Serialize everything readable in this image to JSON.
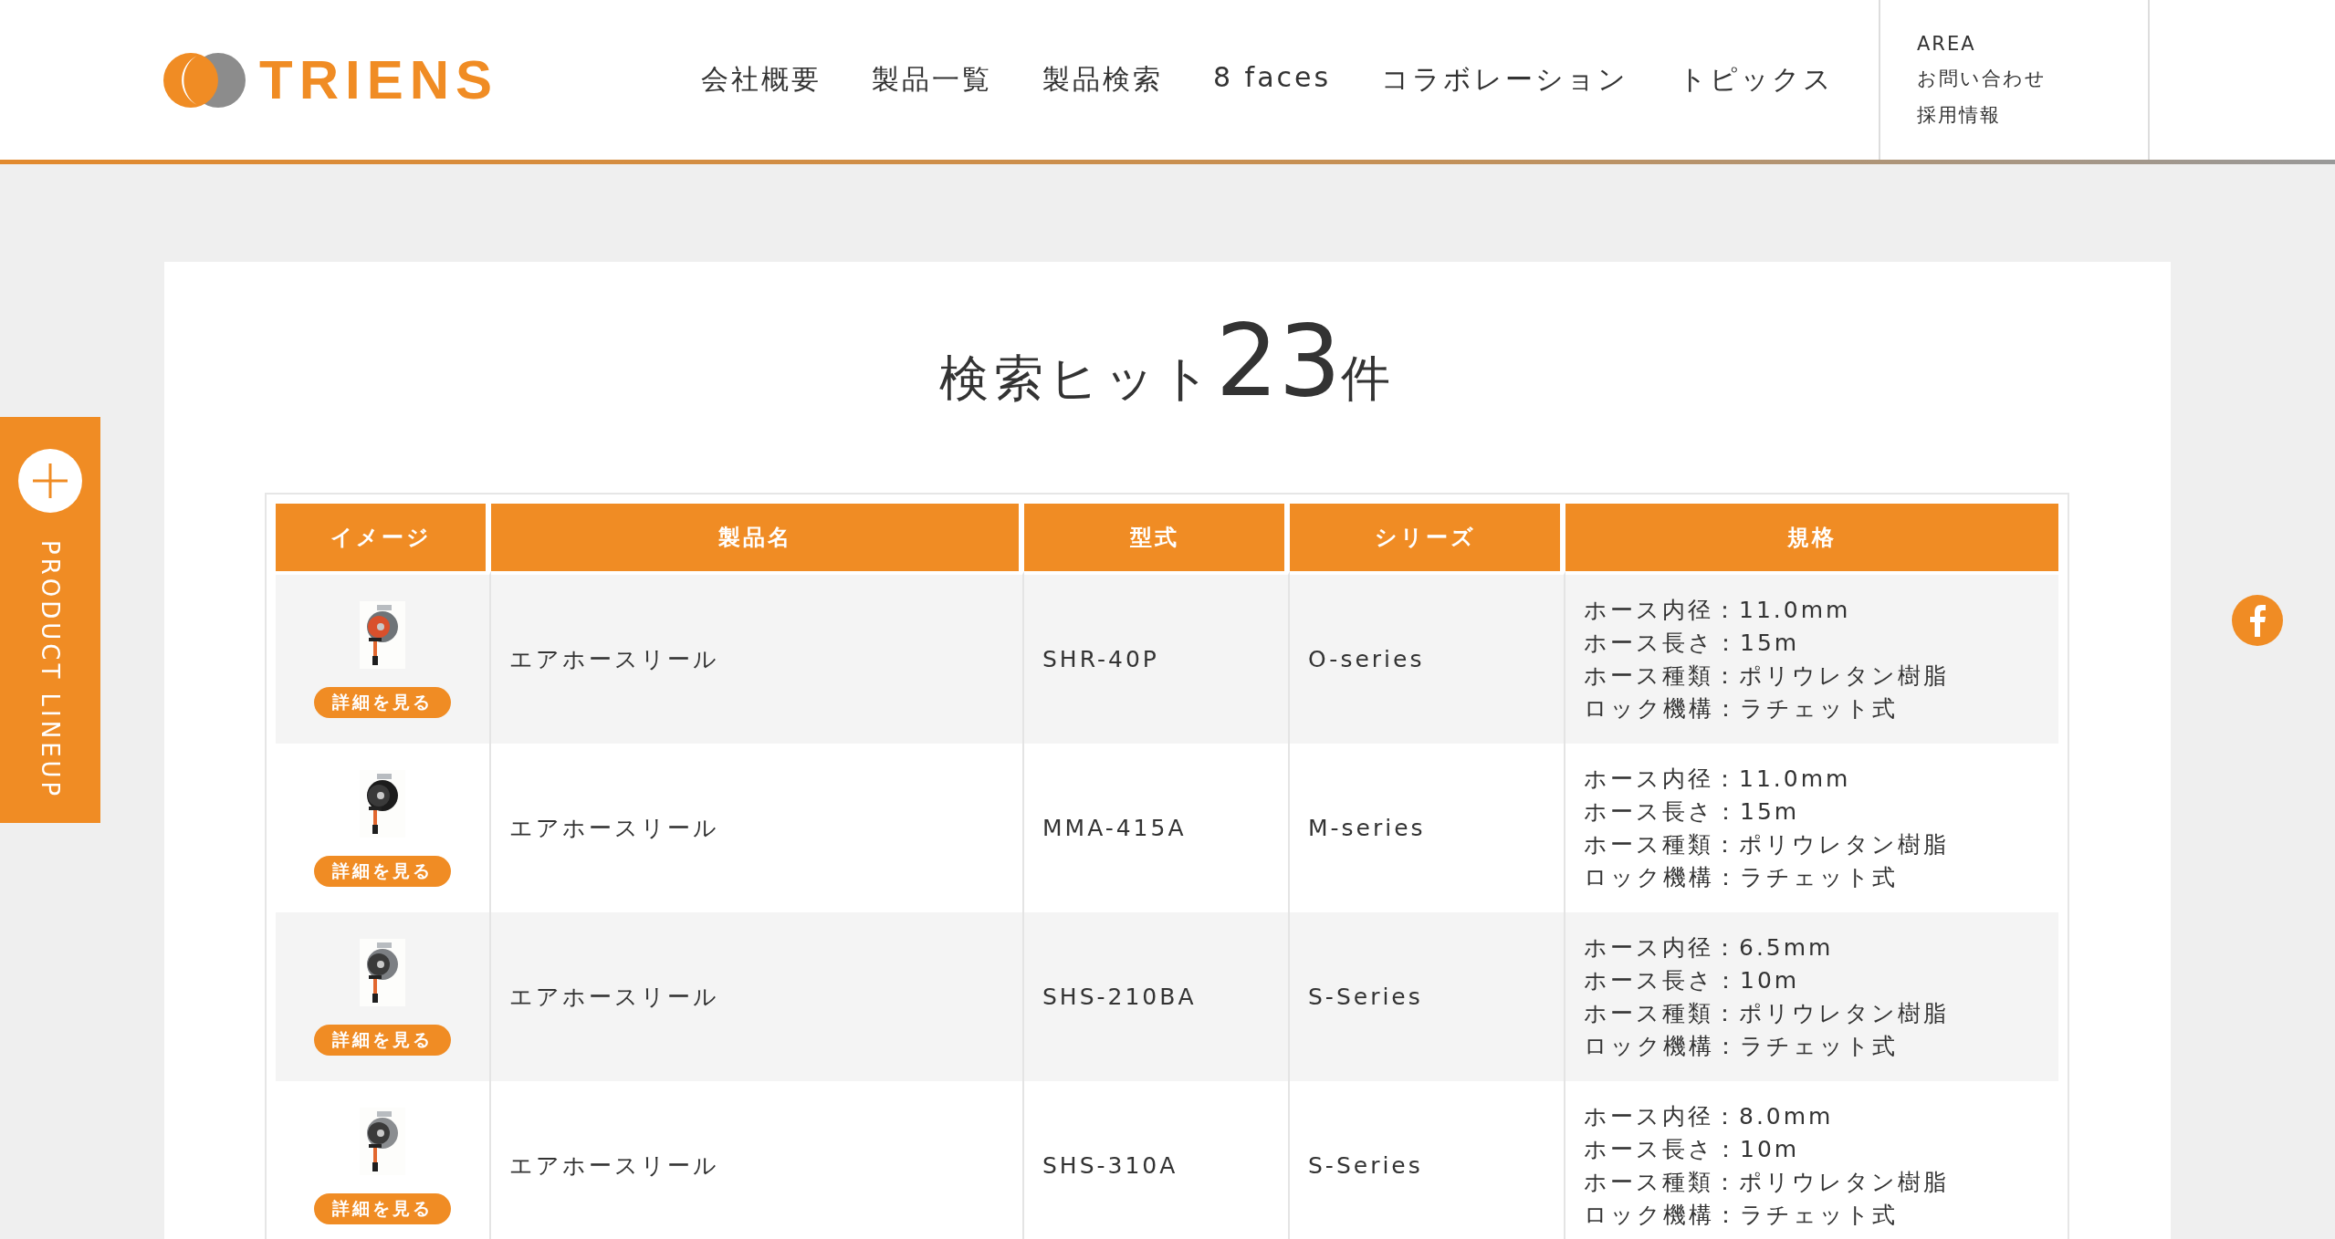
{
  "header": {
    "logo": "TRIENS",
    "nav": [
      "会社概要",
      "製品一覧",
      "製品検索",
      "8 faces",
      "コラボレーション",
      "トピックス"
    ],
    "sub_nav": [
      "AREA",
      "お問い合わせ",
      "採用情報"
    ]
  },
  "side_tab": {
    "label": "PRODUCT LINEUP"
  },
  "heading": {
    "prefix": "検索ヒット",
    "count": "23",
    "suffix": "件"
  },
  "table": {
    "columns": [
      "イメージ",
      "製品名",
      "型式",
      "シリーズ",
      "規格"
    ],
    "rows": [
      {
        "image": {
          "kind": "picture"
        },
        "button": "詳細を見る",
        "name": "エアホースリール",
        "model": "SHR-40P",
        "series": "O-series",
        "specs": [
          "ホース内径：11.0mm",
          "ホース長さ：15m",
          "ホース種類：ポリウレタン樹脂",
          "ロック機構：ラチェット式"
        ]
      },
      {
        "image": {
          "kind": "picture"
        },
        "button": "詳細を見る",
        "name": "エアホースリール",
        "model": "MMA-415A",
        "series": "M-series",
        "specs": [
          "ホース内径：11.0mm",
          "ホース長さ：15m",
          "ホース種類：ポリウレタン樹脂",
          "ロック機構：ラチェット式"
        ]
      },
      {
        "image": {
          "kind": "picture"
        },
        "button": "詳細を見る",
        "name": "エアホースリール",
        "model": "SHS-210BA",
        "series": "S-Series",
        "specs": [
          "ホース内径：6.5mm",
          "ホース長さ：10m",
          "ホース種類：ポリウレタン樹脂",
          "ロック機構：ラチェット式"
        ]
      },
      {
        "image": {
          "kind": "picture"
        },
        "button": "詳細を見る",
        "name": "エアホースリール",
        "model": "SHS-310A",
        "series": "S-Series",
        "specs": [
          "ホース内径：8.0mm",
          "ホース長さ：10m",
          "ホース種類：ポリウレタン樹脂",
          "ロック機構：ラチェット式"
        ]
      }
    ]
  }
}
